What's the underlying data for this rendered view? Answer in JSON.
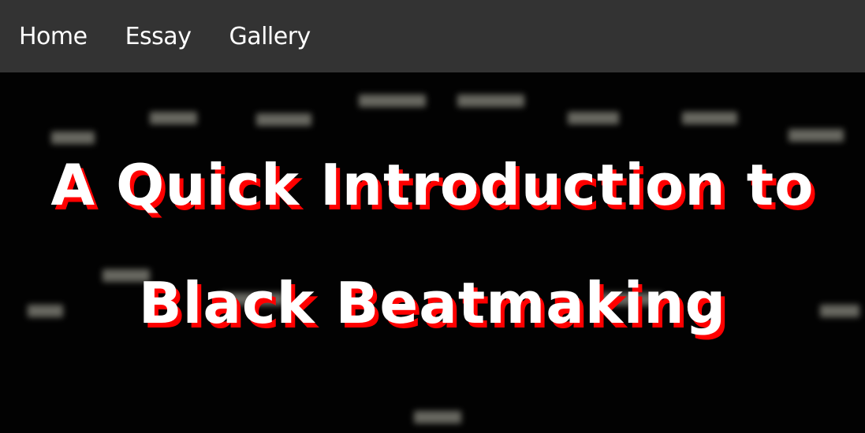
{
  "nav": {
    "items": [
      "Home",
      "Essay",
      "Gallery"
    ]
  },
  "hero": {
    "title_line1": "A Quick Introduction to",
    "title_line2": "Black Beatmaking"
  },
  "colors": {
    "nav_bg": "#333333",
    "title_shadow": "#ff0000"
  }
}
